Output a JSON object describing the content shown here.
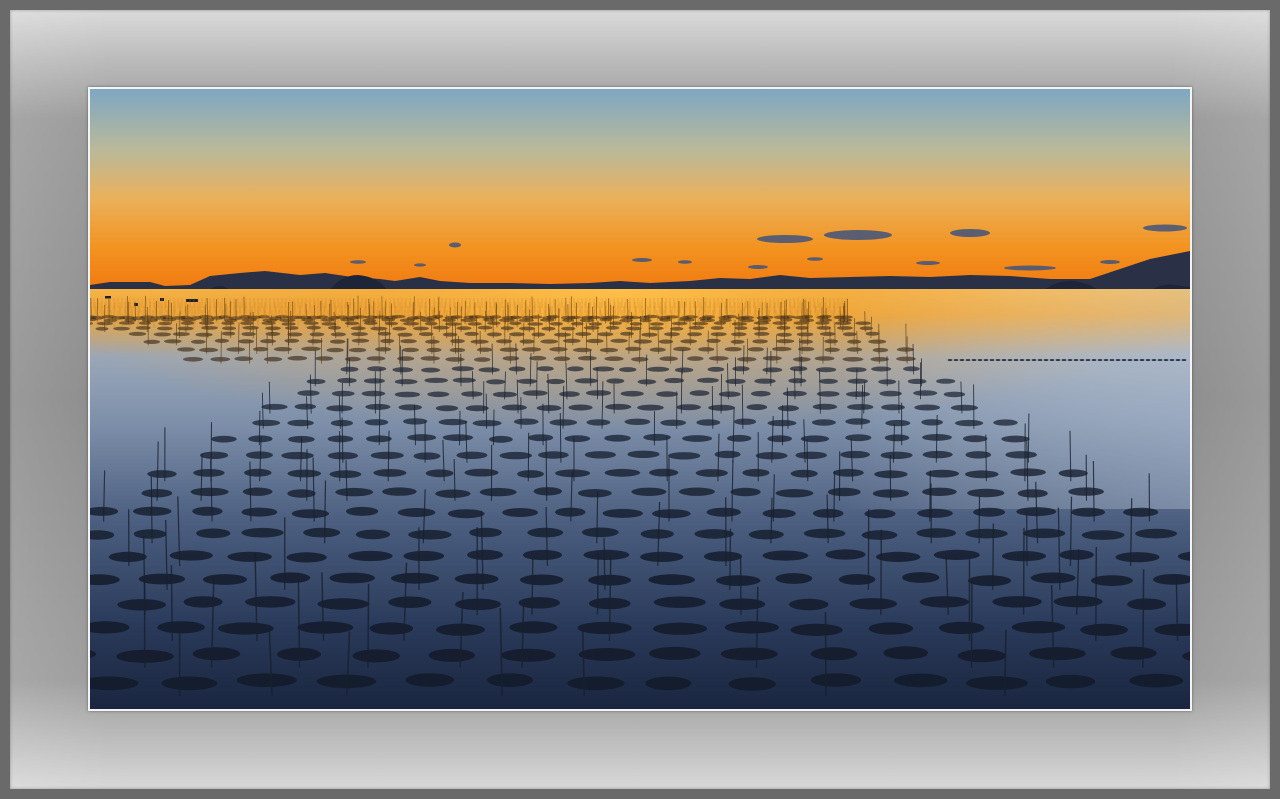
{
  "image": {
    "subject": "photo",
    "colors": {
      "sky_top": "#7fa6c0",
      "sky_mid": "#e8b95e",
      "sky_horizon": "#f28a1e",
      "water_glow": "#f5a623",
      "water_deep": "#1c2a44",
      "silhouette": "#1d2436",
      "mat": "#9a9a9a",
      "photo_border": "#f4f4f4"
    }
  }
}
